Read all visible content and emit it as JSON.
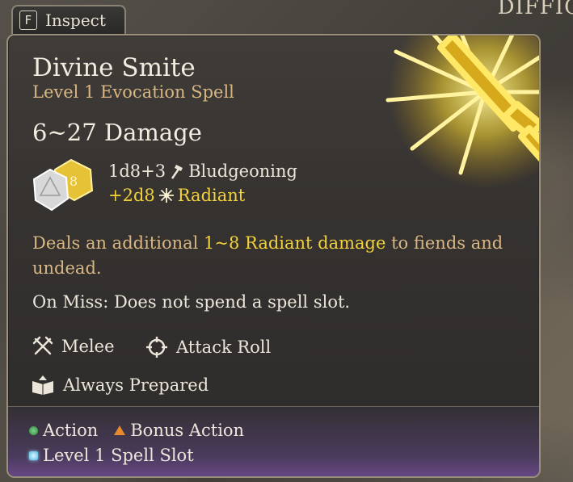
{
  "window": {
    "corner_text": "DIFFIC\nUL"
  },
  "inspect": {
    "key": "F",
    "label": "Inspect"
  },
  "spell": {
    "name": "Divine Smite",
    "subtitle": "Level 1 Evocation Spell",
    "damage_range": "6~27 Damage",
    "damage_lines": [
      {
        "dice": "1d8+3",
        "icon": "hammer-icon",
        "type": "Bludgeoning"
      },
      {
        "dice": "+2d8",
        "icon": "radiant-sun-icon",
        "type": "Radiant"
      }
    ],
    "description": {
      "pre": "Deals an additional ",
      "highlight": "1~8 Radiant damage",
      "post": " to fiends and undead."
    },
    "on_miss": "On Miss: Does not spend a spell slot.",
    "properties": {
      "range": "Melee",
      "roll": "Attack Roll",
      "prepared": "Always Prepared"
    },
    "costs": {
      "action": "Action",
      "bonus_action": "Bonus Action",
      "slot": "Level 1 Spell Slot"
    }
  },
  "colors": {
    "accent_gold": "#f2d23c",
    "subtitle_tan": "#d8b782",
    "text_light": "#ece6da",
    "action_green": "#3f9a4c",
    "bonus_orange": "#e68a2e",
    "slot_blue": "#7fd0f0"
  }
}
